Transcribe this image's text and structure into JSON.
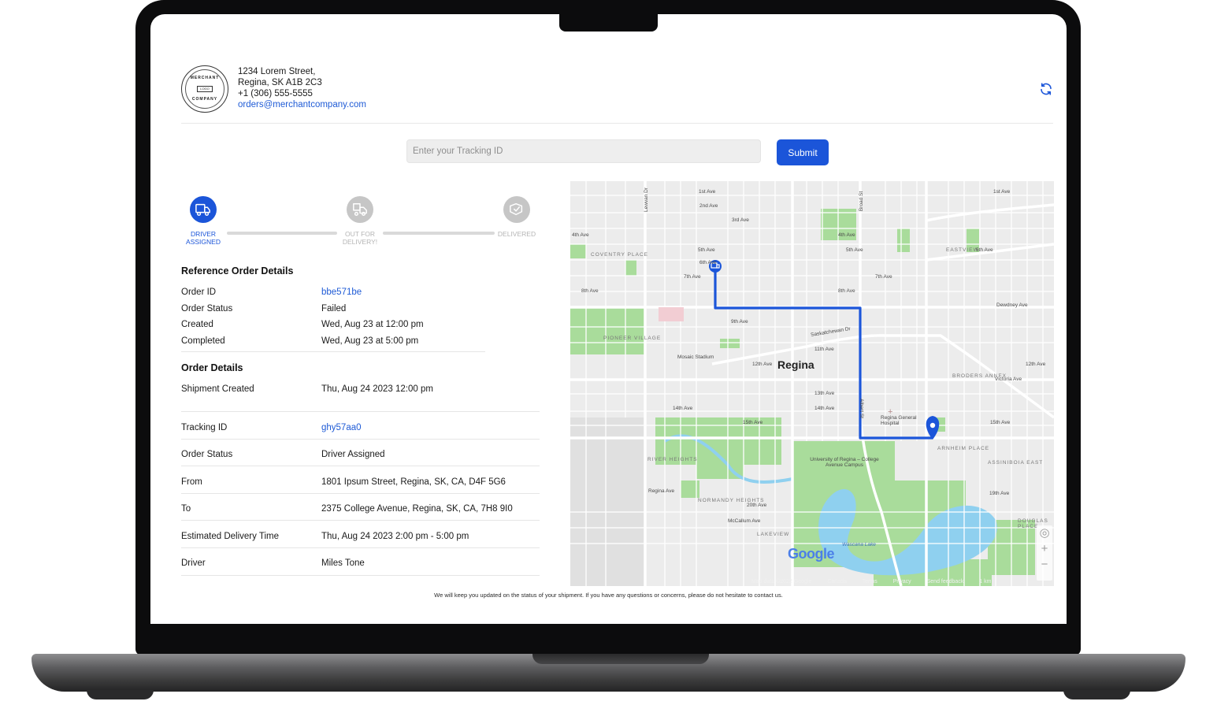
{
  "merchant": {
    "logo_top": "MERCHANT",
    "logo_center": "LOGO",
    "logo_bottom": "COMPANY",
    "address_line1": "1234 Lorem Street,",
    "address_line2": "Regina, SK A1B 2C3",
    "phone": "+1 (306) 555-5555",
    "email": "orders@merchantcompany.com"
  },
  "tracking_form": {
    "placeholder": "Enter your Tracking ID",
    "submit_label": "Submit"
  },
  "stepper": {
    "steps": [
      {
        "line1": "DRIVER",
        "line2": "ASSIGNED",
        "state": "active"
      },
      {
        "line1": "OUT FOR",
        "line2": "DELIVERY!",
        "state": "inactive"
      },
      {
        "line1": "DELIVERED",
        "line2": "",
        "state": "inactive"
      }
    ]
  },
  "reference": {
    "title": "Reference Order Details",
    "rows": [
      {
        "label": "Order ID",
        "value": "bbe571be"
      },
      {
        "label": "Order Status",
        "value": "Failed"
      },
      {
        "label": "Created",
        "value": "Wed, Aug 23 at 12:00 pm"
      },
      {
        "label": "Completed",
        "value": "Wed, Aug 23 at 5:00 pm"
      }
    ]
  },
  "order": {
    "title": "Order Details",
    "shipment_label": "Shipment Created",
    "shipment_value": "Thu, Aug 24 2023 12:00 pm",
    "rows": [
      {
        "label": "Tracking ID",
        "value": "ghy57aa0"
      },
      {
        "label": "Order Status",
        "value": "Driver Assigned"
      },
      {
        "label": "From",
        "value": "1801 Ipsum Street, Regina, SK, CA, D4F 5G6"
      },
      {
        "label": "To",
        "value": "2375 College Avenue, Regina, SK, CA, 7H8 9I0"
      },
      {
        "label": "Estimated Delivery Time",
        "value": "Thu, Aug 24 2023 2:00 pm - 5:00 pm"
      },
      {
        "label": "Driver",
        "value": "Miles Tone"
      }
    ]
  },
  "map": {
    "city": "Regina",
    "streets": [
      "1st Ave",
      "2nd Ave",
      "3rd Ave",
      "4th Ave",
      "5th Ave",
      "6th Ave",
      "7th Ave",
      "8th Ave",
      "9th Ave",
      "11th Ave",
      "12th Ave",
      "13th Ave",
      "14th Ave",
      "15th Ave",
      "19th Ave",
      "20th Ave",
      "Saskatchewan Dr",
      "Dewdney Ave",
      "Victoria Ave",
      "Regina Ave",
      "McCallum Ave",
      "Broad St",
      "Albert St",
      "Lewvan Dr"
    ],
    "neighborhoods": [
      "COVENTRY PLACE",
      "PIONEER VILLAGE",
      "RIVER HEIGHTS",
      "NORMANDY HEIGHTS",
      "LAKEVIEW",
      "EASTVIEW",
      "BRODERS ANNEX",
      "ARNHEIM PLACE",
      "ASSINIBOIA EAST",
      "DOUGLAS PLACE"
    ],
    "landmarks": [
      "Mosaic Stadium",
      "Regina General Hospital",
      "University of Regina – College Avenue Campus",
      "Wascana Lake"
    ],
    "google": "Google",
    "footer": [
      "Map data ©2022 Google",
      "Canada",
      "Terms",
      "Privacy",
      "Send feedback",
      "1 km"
    ],
    "colors": {
      "route": "#1b55d9",
      "water": "#8fd0ef",
      "park": "#a9dc9b",
      "road": "#ffffff",
      "land": "#ececec"
    }
  },
  "footer_note": "We will keep you updated on the status of your shipment. If you have any questions or concerns, please do not hesitate to contact us."
}
